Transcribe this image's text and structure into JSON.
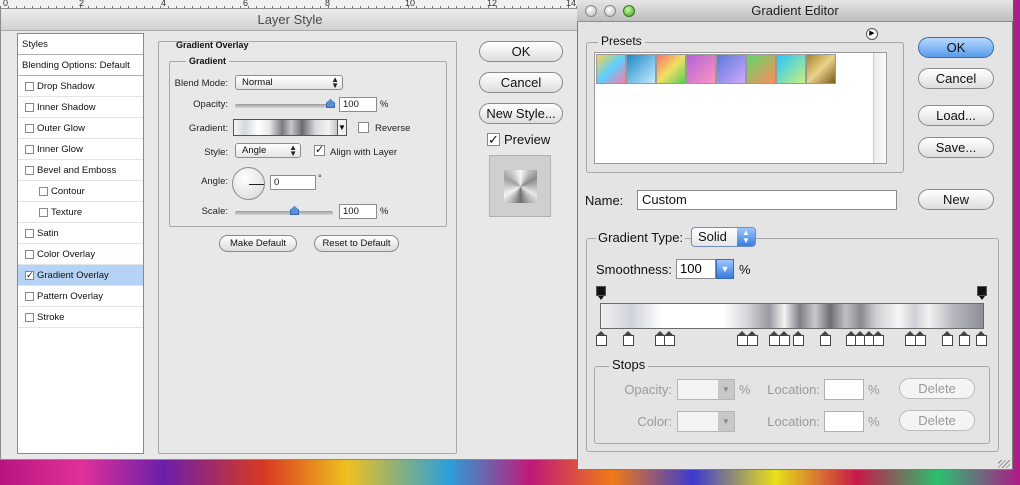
{
  "ruler": {
    "marks": [
      "0",
      "2",
      "4",
      "6",
      "8",
      "10",
      "12",
      "14"
    ]
  },
  "layer_style": {
    "title": "Layer Style",
    "styles_list": [
      {
        "label": "Styles",
        "type": "head"
      },
      {
        "label": "Blending Options: Default",
        "type": "head"
      },
      {
        "label": "Drop Shadow",
        "checked": false
      },
      {
        "label": "Inner Shadow",
        "checked": false
      },
      {
        "label": "Outer Glow",
        "checked": false
      },
      {
        "label": "Inner Glow",
        "checked": false
      },
      {
        "label": "Bevel and Emboss",
        "checked": false
      },
      {
        "label": "Contour",
        "checked": false,
        "sub": true
      },
      {
        "label": "Texture",
        "checked": false,
        "sub": true
      },
      {
        "label": "Satin",
        "checked": false
      },
      {
        "label": "Color Overlay",
        "checked": false
      },
      {
        "label": "Gradient Overlay",
        "checked": true,
        "selected": true
      },
      {
        "label": "Pattern Overlay",
        "checked": false
      },
      {
        "label": "Stroke",
        "checked": false
      }
    ],
    "section_title": "Gradient Overlay",
    "group_title": "Gradient",
    "blend_mode_label": "Blend Mode:",
    "blend_mode_value": "Normal",
    "opacity_label": "Opacity:",
    "opacity_value": "100",
    "opacity_unit": "%",
    "gradient_label": "Gradient:",
    "reverse_label": "Reverse",
    "reverse_checked": false,
    "style_label": "Style:",
    "style_value": "Angle",
    "align_label": "Align with Layer",
    "align_checked": true,
    "angle_label": "Angle:",
    "angle_value": "0",
    "angle_unit": "°",
    "scale_label": "Scale:",
    "scale_value": "100",
    "scale_unit": "%",
    "make_default": "Make Default",
    "reset_default": "Reset to Default",
    "ok": "OK",
    "cancel": "Cancel",
    "new_style": "New Style...",
    "preview_label": "Preview",
    "preview_checked": true
  },
  "gradient_editor": {
    "title": "Gradient Editor",
    "presets_label": "Presets",
    "ok": "OK",
    "cancel": "Cancel",
    "load": "Load...",
    "save": "Save...",
    "name_label": "Name:",
    "name_value": "Custom",
    "new_button": "New",
    "gradient_type_label": "Gradient Type:",
    "gradient_type_value": "Solid",
    "smoothness_label": "Smoothness:",
    "smoothness_value": "100",
    "smoothness_unit": "%",
    "stops_label": "Stops",
    "opacity_label": "Opacity:",
    "color_label": "Color:",
    "location_label": "Location:",
    "location_unit": "%",
    "delete_label": "Delete",
    "accent_color": "#3a7cde"
  }
}
